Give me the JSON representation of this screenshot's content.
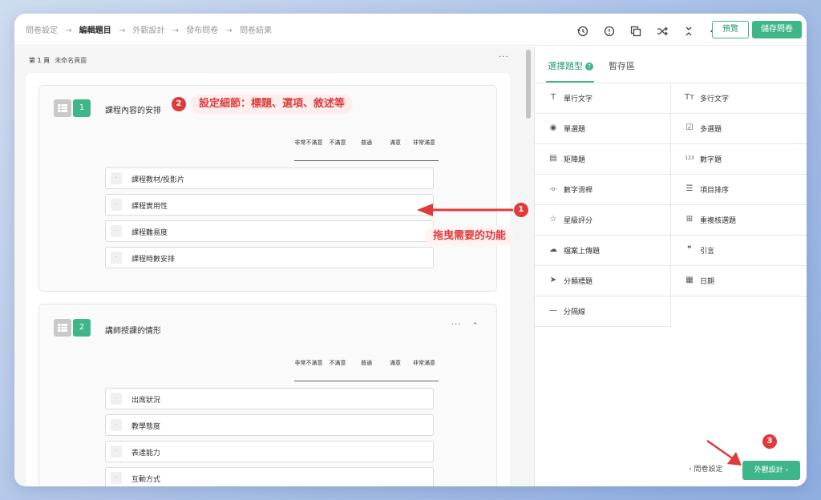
{
  "breadcrumb": [
    {
      "label": "問卷設定",
      "active": false
    },
    {
      "label": "編輯題目",
      "active": true
    },
    {
      "label": "外觀設計",
      "active": false
    },
    {
      "label": "發布問卷",
      "active": false
    },
    {
      "label": "問卷結果",
      "active": false
    }
  ],
  "breadcrumb_arrow": "→",
  "toolbar": {
    "icons": [
      "history-icon",
      "info-icon",
      "copy-icon",
      "shuffle-icon",
      "collapse-icon",
      "more-icon"
    ],
    "more_label": "···",
    "collapse_label": "⌃⌄",
    "preview_label": "預覽",
    "save_label": "儲存問卷"
  },
  "page": {
    "number_label": "第 1 頁",
    "name": "未命名頁面",
    "more_label": "···"
  },
  "scale_labels": [
    "非常不滿意",
    "不滿意",
    "普通",
    "滿意",
    "非常滿意"
  ],
  "questions": [
    {
      "number": "1",
      "title": "課程內容的安排",
      "rows": [
        "課程教材/投影片",
        "課程實用性",
        "課程難易度",
        "課程時數安排"
      ]
    },
    {
      "number": "2",
      "title": "講師授課的情形",
      "rows": [
        "出席狀況",
        "教學態度",
        "表達能力",
        "互動方式"
      ],
      "more_label": "···",
      "collapse_label": "⌃"
    }
  ],
  "row_handle": "·",
  "right_panel": {
    "tab_active": "選擇題型",
    "tab_help": "?",
    "tab_inactive": "暫存區",
    "question_types": [
      {
        "icon": "text-icon",
        "glyph": "T",
        "label": "單行文字"
      },
      {
        "icon": "multiline-text-icon",
        "glyph": "Tт",
        "label": "多行文字"
      },
      {
        "icon": "radio-icon",
        "glyph": "◉",
        "label": "單選題"
      },
      {
        "icon": "checkbox-icon",
        "glyph": "☑",
        "label": "多選題"
      },
      {
        "icon": "matrix-icon",
        "glyph": "▤",
        "label": "矩陣題"
      },
      {
        "icon": "number-icon",
        "glyph": "123",
        "label": "數字題"
      },
      {
        "icon": "slider-icon",
        "glyph": "-o-",
        "label": "數字滑桿"
      },
      {
        "icon": "ranking-icon",
        "glyph": "☰",
        "label": "項目排序"
      },
      {
        "icon": "star-icon",
        "glyph": "☆",
        "label": "星級評分"
      },
      {
        "icon": "hierarchy-icon",
        "glyph": "⊞",
        "label": "重複核選題"
      },
      {
        "icon": "upload-icon",
        "glyph": "☁",
        "label": "檔案上傳題"
      },
      {
        "icon": "quote-icon",
        "glyph": "❞",
        "label": "引言"
      },
      {
        "icon": "section-icon",
        "glyph": "➤",
        "label": "分類標題"
      },
      {
        "icon": "calendar-icon",
        "glyph": "▦",
        "label": "日期"
      },
      {
        "icon": "divider-icon",
        "glyph": "—",
        "label": "分隔線"
      }
    ],
    "back_label": "‹  問卷設定",
    "next_label": "外觀設計  ›"
  },
  "annotations": {
    "badge1": "1",
    "text1": "拖曳需要的功能",
    "badge2": "2",
    "text2": "設定細節：標題、選項、敘述等",
    "badge3": "3"
  },
  "colors": {
    "accent": "#3fb58a",
    "annotation": "#e03a3a"
  }
}
